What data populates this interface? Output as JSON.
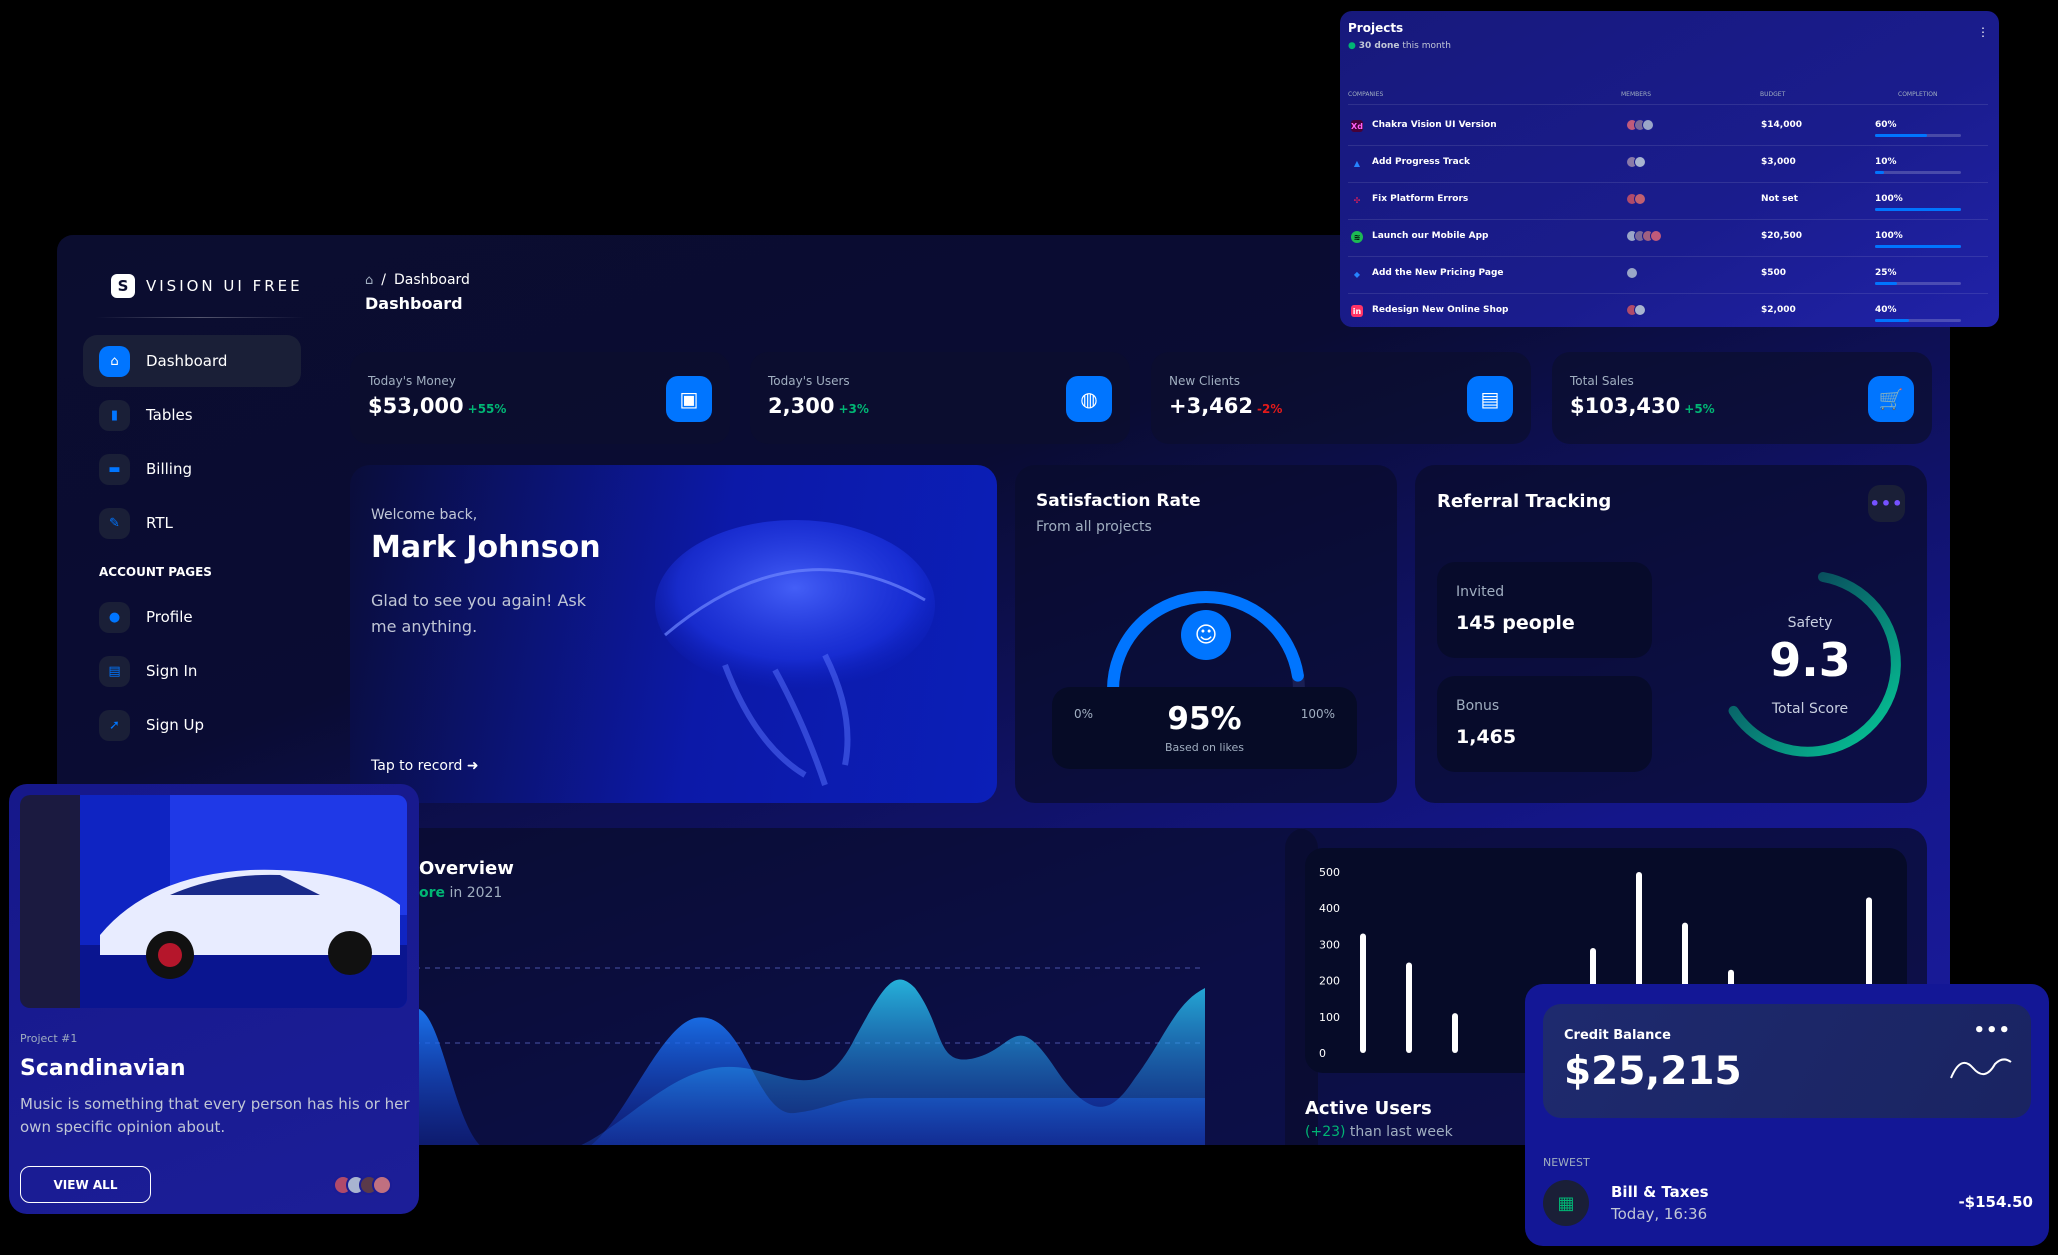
{
  "colors": {
    "accent": "#0075ff",
    "positive": "#01b574",
    "negative": "#e31a1a",
    "teal": "#05cd99",
    "cyan": "#2cd9ff"
  },
  "sidebar": {
    "logo_letter": "S",
    "logo_text": "VISION UI FREE",
    "items": [
      {
        "label": "Dashboard",
        "icon": "home-icon",
        "active": true
      },
      {
        "label": "Tables",
        "icon": "bar-chart-icon"
      },
      {
        "label": "Billing",
        "icon": "credit-card-icon"
      },
      {
        "label": "RTL",
        "icon": "wrench-icon"
      }
    ],
    "section_title": "ACCOUNT PAGES",
    "account_items": [
      {
        "label": "Profile",
        "icon": "person-icon"
      },
      {
        "label": "Sign In",
        "icon": "document-icon"
      },
      {
        "label": "Sign Up",
        "icon": "rocket-icon"
      }
    ]
  },
  "header": {
    "breadcrumb_sep": "/",
    "breadcrumb": "Dashboard",
    "title": "Dashboard"
  },
  "stats": [
    {
      "label": "Today's Money",
      "value": "$53,000",
      "change": "+55%",
      "icon": "wallet-icon",
      "positive": true
    },
    {
      "label": "Today's Users",
      "value": "2,300",
      "change": "+3%",
      "icon": "globe-icon",
      "positive": true
    },
    {
      "label": "New Clients",
      "value": "+3,462",
      "change": "-2%",
      "icon": "document-icon",
      "positive": false
    },
    {
      "label": "Total Sales",
      "value": "$103,430",
      "change": "+5%",
      "icon": "cart-icon",
      "positive": true
    }
  ],
  "welcome": {
    "greeting": "Welcome back,",
    "name": "Mark Johnson",
    "message": "Glad to see you again! Ask me anything.",
    "tap": "Tap to record"
  },
  "satisfaction": {
    "title": "Satisfaction Rate",
    "subtitle": "From all projects",
    "min_label": "0%",
    "max_label": "100%",
    "percent": "95%",
    "percent_value": 0.95,
    "based": "Based on likes"
  },
  "referral": {
    "title": "Referral Tracking",
    "invited_label": "Invited",
    "invited_value": "145 people",
    "bonus_label": "Bonus",
    "bonus_value": "1,465",
    "safety_label": "Safety",
    "score": "9.3",
    "score_value": 9.3,
    "total_label": "Total Score"
  },
  "overview": {
    "title": "Overview",
    "sub_prefix": "ore",
    "sub_suffix": "in 2021"
  },
  "active_users": {
    "title": "Active Users",
    "sub_change": "(+23)",
    "sub_text": "than last week"
  },
  "chart_data": {
    "type": "bar",
    "y_ticks": [
      "500",
      "400",
      "300",
      "200",
      "100",
      "0"
    ],
    "ylim": [
      0,
      500
    ],
    "values": [
      330,
      250,
      110,
      0,
      0,
      290,
      500,
      360,
      230,
      0,
      0,
      430
    ]
  },
  "projects": {
    "title": "Projects",
    "done": "30 done",
    "done_suffix": "this month",
    "columns": [
      "COMPANIES",
      "MEMBERS",
      "BUDGET",
      "COMPLETION"
    ],
    "rows": [
      {
        "company": "Chakra Vision UI Version",
        "icon": "xd-icon",
        "budget": "$14,000",
        "completion": "60%",
        "completion_value": 0.6,
        "members": 3
      },
      {
        "company": "Add Progress Track",
        "icon": "atlassian-icon",
        "budget": "$3,000",
        "completion": "10%",
        "completion_value": 0.1,
        "members": 2
      },
      {
        "company": "Fix Platform Errors",
        "icon": "slack-icon",
        "budget": "Not set",
        "completion": "100%",
        "completion_value": 1.0,
        "members": 2
      },
      {
        "company": "Launch our Mobile App",
        "icon": "spotify-icon",
        "budget": "$20,500",
        "completion": "100%",
        "completion_value": 1.0,
        "members": 4
      },
      {
        "company": "Add the New Pricing Page",
        "icon": "jira-icon",
        "budget": "$500",
        "completion": "25%",
        "completion_value": 0.25,
        "members": 1
      },
      {
        "company": "Redesign New Online Shop",
        "icon": "invision-icon",
        "budget": "$2,000",
        "completion": "40%",
        "completion_value": 0.4,
        "members": 2
      }
    ]
  },
  "project_card": {
    "number": "Project #1",
    "title": "Scandinavian",
    "description": "Music is something that every person has his or her own specific opinion about.",
    "button": "VIEW ALL"
  },
  "credit": {
    "label": "Credit Balance",
    "value": "$25,215",
    "newest": "NEWEST",
    "bill": "Bill & Taxes",
    "time": "Today, 16:36",
    "amount": "-$154.50"
  }
}
